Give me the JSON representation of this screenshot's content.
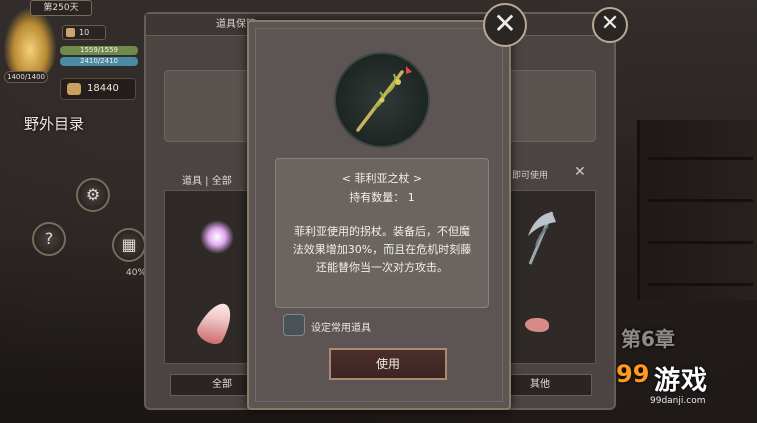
{
  "hud": {
    "day": "第250天",
    "hp": "1400/1400",
    "stamina": "10",
    "bar1": "1559/1559",
    "bar2": "2410/2410",
    "gold": "18440",
    "field_label": "野外目录",
    "progress_label": "40%"
  },
  "background": {
    "chapter": "第6章"
  },
  "storage_panel": {
    "title": "道具保管",
    "tabs": "道具 | 全部",
    "usable_hint": "即可使用",
    "bottom_buttons": [
      "全部",
      "其他"
    ]
  },
  "item_detail": {
    "name": "< 菲利亚之杖 >",
    "count_label": "持有数量：",
    "count_value": "1",
    "description": "菲利亚使用的拐杖。装备后，不但魔法效果增加30%，而且在危机时刻藤还能替你当一次对方攻击。",
    "checkbox_label": "设定常用道具",
    "use_button": "使用"
  },
  "watermark": {
    "brand": "游戏",
    "number": "99",
    "url": "99danji.com"
  },
  "icons": {
    "close": "close-icon",
    "gear": "gear-icon",
    "help": "question-icon"
  }
}
